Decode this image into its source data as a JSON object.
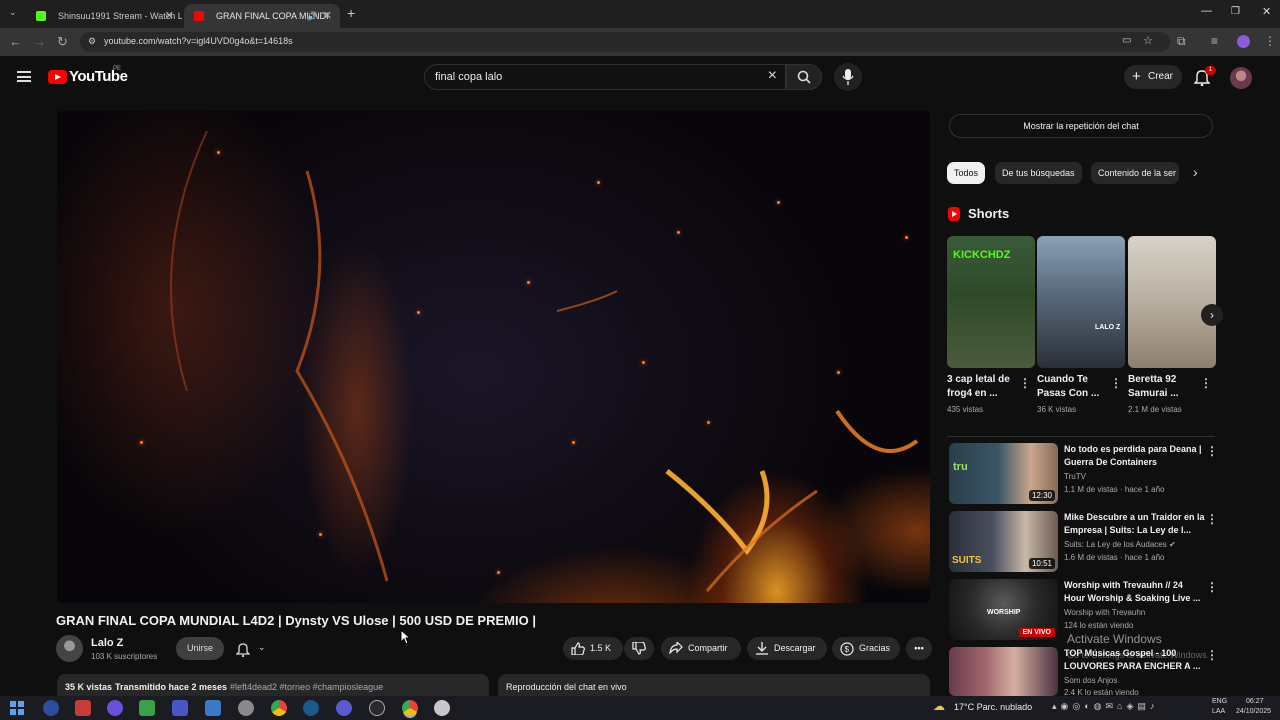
{
  "browser": {
    "tabs": [
      {
        "label": "Shinsuu1991 Stream - Watch Li",
        "active": false,
        "favicon_color": "#53fc18"
      },
      {
        "label": "GRAN FINAL COPA MUNDI",
        "active": true,
        "favicon_color": "#ff0000"
      }
    ],
    "url": "youtube.com/watch?v=igl4UVD0g4o&t=14618s"
  },
  "header": {
    "logo_text": "YouTube",
    "region": "PE",
    "search_value": "final copa lalo",
    "create_label": "Crear",
    "notification_count": "1"
  },
  "video": {
    "title": "GRAN FINAL COPA MUNDIAL L4D2 | Dynsty VS Ulose | 500 USD DE PREMIO |",
    "channel_name": "Lalo Z",
    "channel_subs": "103 K suscriptores",
    "join_label": "Unirse",
    "likes": "1.5 K",
    "share_label": "Compartir",
    "download_label": "Descargar",
    "thanks_label": "Gracias",
    "views": "35 K vistas",
    "streamed": "Transmitido hace 2 meses",
    "tags": "#left4dead2 #torneo #champiosleague",
    "chat_replay_label": "Reproducción del chat en vivo"
  },
  "sidebar": {
    "show_chat_label": "Mostrar la repetición del chat",
    "chips": [
      "Todos",
      "De tus búsquedas",
      "Contenido de la ser"
    ],
    "shorts_title": "Shorts",
    "shorts": [
      {
        "title": "3 cap letal de frog4 en ...",
        "views": "435 vistas",
        "thumb_text": "KICKCHDZ"
      },
      {
        "title": "Cuando Te Pasas Con ...",
        "views": "36 K vistas",
        "thumb_text": "LALO Z"
      },
      {
        "title": "Beretta 92 Samurai ...",
        "views": "2.1 M de vistas",
        "thumb_text": ""
      }
    ],
    "recommendations": [
      {
        "title": "No todo es perdida para Deana | Guerra De Containers",
        "channel": "TruTV",
        "meta": "1.1 M de vistas · hace 1 año",
        "duration": "12:30",
        "live": false,
        "verified": false
      },
      {
        "title": "Mike Descubre a un Traidor en la Empresa | Suits: La Ley de l...",
        "channel": "Suits: La Ley de los Audaces",
        "meta": "1.6 M de vistas · hace 1 año",
        "duration": "10:51",
        "live": false,
        "verified": true
      },
      {
        "title": "Worship with Trevauhn // 24 Hour Worship & Soaking Live ...",
        "channel": "Worship with Trevauhn",
        "meta": "124 lo están viendo",
        "duration": "EN VIVO",
        "live": true,
        "verified": false
      },
      {
        "title": "TOP Músicas Gospel - 100 LOUVORES PARA ENCHER A ...",
        "channel": "Som dos Anjos",
        "meta": "2.4 K lo están viendo",
        "duration": "",
        "live": true,
        "verified": false
      }
    ]
  },
  "watermark": {
    "line1": "Activate Windows",
    "line2": "Go to Settings to activate Windows."
  },
  "taskbar": {
    "weather": "17°C  Parc. nublado",
    "lang1": "ENG",
    "lang2": "LAA",
    "time": "06:27",
    "date": "24/10/2025"
  }
}
